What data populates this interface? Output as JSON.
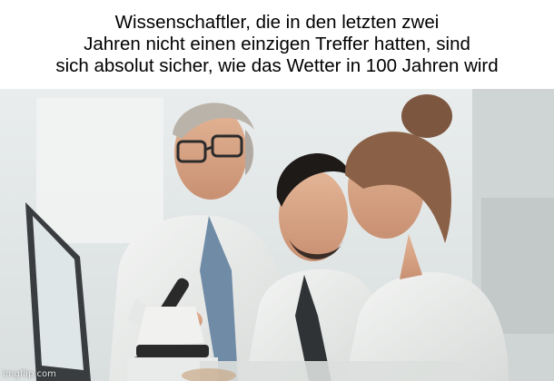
{
  "meme": {
    "caption_lines": [
      "Wissenschaftler, die in den letzten zwei",
      "Jahren nicht einen einzigen Treffer hatten, sind",
      "sich absolut sicher, wie das Wetter in 100 Jahren wird"
    ],
    "watermark": "imgflip.com"
  },
  "colors": {
    "background": "#ffffff",
    "lab_wall": "#e6eaea",
    "lab_coat": "#eceeed"
  }
}
